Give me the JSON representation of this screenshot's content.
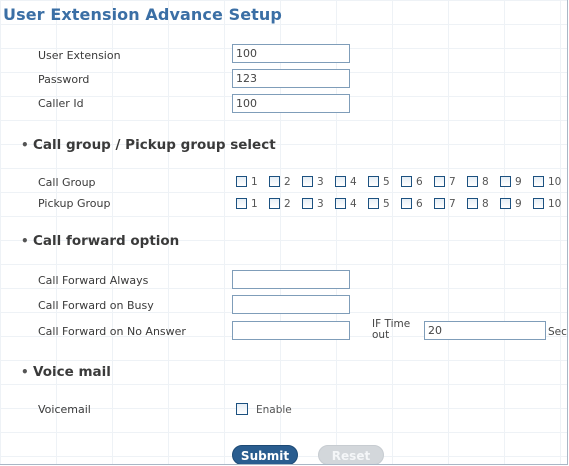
{
  "title": "User Extension Advance Setup",
  "basic": {
    "user_extension_label": "User Extension",
    "user_extension_value": "100",
    "password_label": "Password",
    "password_value": "123",
    "caller_id_label": "Caller Id",
    "caller_id_value": "100"
  },
  "groups": {
    "heading": "Call group / Pickup group select",
    "call_group_label": "Call Group",
    "pickup_group_label": "Pickup Group",
    "numbers": [
      "1",
      "2",
      "3",
      "4",
      "5",
      "6",
      "7",
      "8",
      "9",
      "10"
    ]
  },
  "forward": {
    "heading": "Call forward option",
    "always_label": "Call Forward Always",
    "always_value": "",
    "busy_label": "Call Forward on Busy",
    "busy_value": "",
    "no_answer_label": "Call Forward on No Answer",
    "no_answer_value": "",
    "timeout_label": "IF Time out",
    "timeout_value": "20",
    "timeout_unit": "Sec"
  },
  "voicemail": {
    "heading": "Voice mail",
    "label": "Voicemail",
    "enable_label": "Enable"
  },
  "buttons": {
    "submit_label": "Submit",
    "reset_label": "Reset"
  },
  "colors": {
    "title": "#3b6fa5",
    "submit_bg": "#2a5d8f",
    "reset_bg": "#d3d7db",
    "checkbox_border": "#1c5180"
  }
}
